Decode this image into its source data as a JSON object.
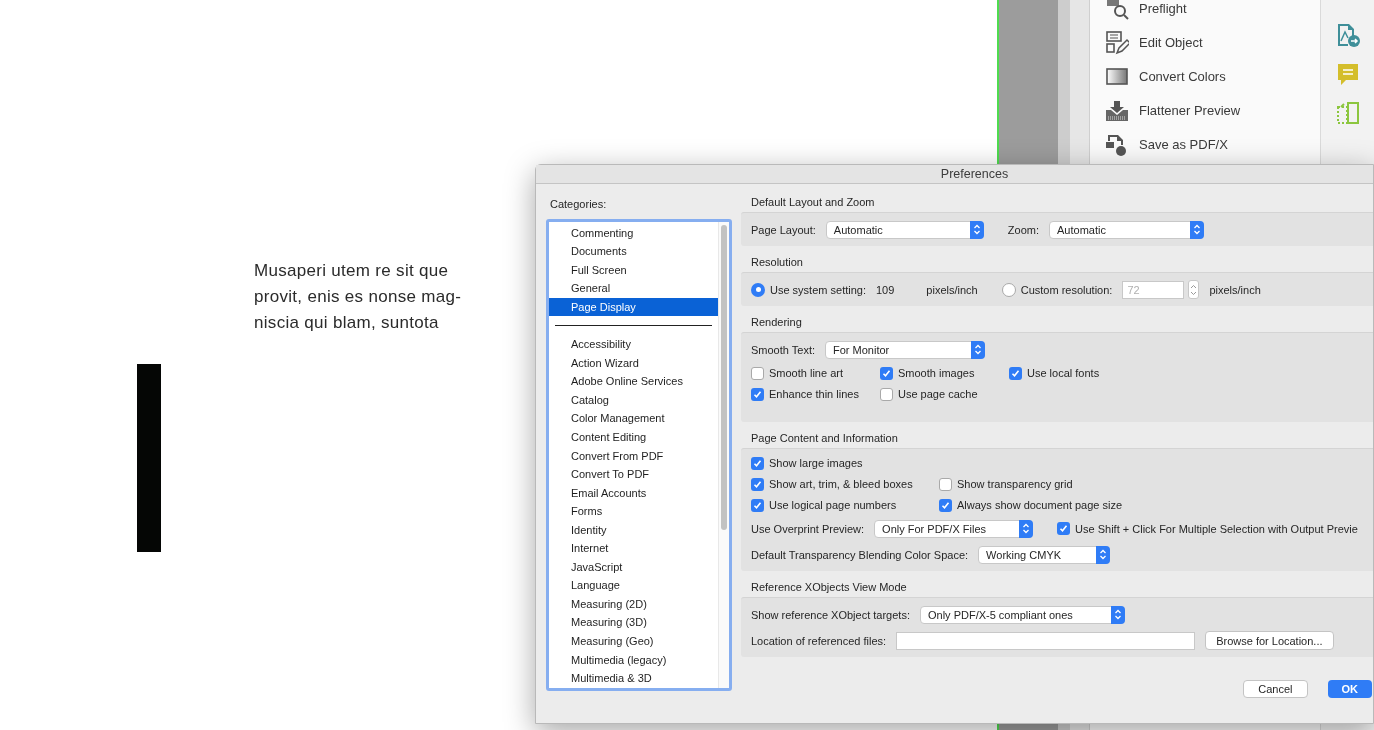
{
  "document": {
    "body_lines": [
      "Musaperi utem re sit que",
      "provit, enis es nonse mag-",
      "niscia qui blam, suntota"
    ]
  },
  "tools_panel": {
    "items": [
      {
        "label": "Preflight",
        "kind": "preflight"
      },
      {
        "label": "Edit Object",
        "kind": "edit"
      },
      {
        "label": "Convert Colors",
        "kind": "colors"
      },
      {
        "label": "Flattener Preview",
        "kind": "flatten"
      },
      {
        "label": "Save as PDF/X",
        "kind": "save"
      }
    ]
  },
  "dialog": {
    "title": "Preferences",
    "categories_label": "Categories:",
    "categories": [
      {
        "label": "Commenting",
        "selected": false
      },
      {
        "label": "Documents",
        "selected": false
      },
      {
        "label": "Full Screen",
        "selected": false
      },
      {
        "label": "General",
        "selected": false
      },
      {
        "label": "Page Display",
        "selected": true
      },
      {
        "kind": "separator"
      },
      {
        "label": "Accessibility",
        "selected": false
      },
      {
        "label": "Action Wizard",
        "selected": false
      },
      {
        "label": "Adobe Online Services",
        "selected": false
      },
      {
        "label": "Catalog",
        "selected": false
      },
      {
        "label": "Color Management",
        "selected": false
      },
      {
        "label": "Content Editing",
        "selected": false
      },
      {
        "label": "Convert From PDF",
        "selected": false
      },
      {
        "label": "Convert To PDF",
        "selected": false
      },
      {
        "label": "Email Accounts",
        "selected": false
      },
      {
        "label": "Forms",
        "selected": false
      },
      {
        "label": "Identity",
        "selected": false
      },
      {
        "label": "Internet",
        "selected": false
      },
      {
        "label": "JavaScript",
        "selected": false
      },
      {
        "label": "Language",
        "selected": false
      },
      {
        "label": "Measuring (2D)",
        "selected": false
      },
      {
        "label": "Measuring (3D)",
        "selected": false
      },
      {
        "label": "Measuring (Geo)",
        "selected": false
      },
      {
        "label": "Multimedia (legacy)",
        "selected": false
      },
      {
        "label": "Multimedia & 3D",
        "selected": false
      }
    ],
    "sections": [
      {
        "title": "Default Layout and Zoom",
        "rows": [
          {
            "kind": "controls",
            "items": [
              {
                "kind": "text",
                "text": "Page Layout:"
              },
              {
                "kind": "select",
                "value": "Automatic"
              },
              {
                "kind": "text",
                "text": "Zoom:"
              },
              {
                "kind": "select",
                "value": "Automatic"
              }
            ]
          }
        ]
      },
      {
        "title": "Resolution",
        "rows": [
          {
            "kind": "controls",
            "items": [
              {
                "kind": "radio",
                "label": "Use system setting:",
                "selected": true
              },
              {
                "kind": "text",
                "text": "109"
              },
              {
                "kind": "text",
                "text": "pixels/inch"
              },
              {
                "kind": "radio",
                "label": "Custom resolution:",
                "selected": false
              },
              {
                "kind": "input",
                "value": "72",
                "disabled": true
              },
              {
                "kind": "spinner"
              },
              {
                "kind": "text",
                "text": "pixels/inch"
              }
            ]
          }
        ]
      },
      {
        "title": "Rendering",
        "rows": [
          {
            "kind": "controls",
            "items": [
              {
                "kind": "text",
                "text": "Smooth Text:"
              },
              {
                "kind": "select",
                "value": "For Monitor"
              }
            ]
          },
          {
            "kind": "checks",
            "items": [
              {
                "label": "Smooth line art",
                "checked": false
              },
              {
                "label": "Smooth images",
                "checked": true
              },
              {
                "label": "Use local fonts",
                "checked": true
              }
            ]
          },
          {
            "kind": "checks",
            "items": [
              {
                "label": "Enhance thin lines",
                "checked": true
              },
              {
                "label": "Use page cache",
                "checked": false
              }
            ]
          }
        ]
      },
      {
        "title": "Page Content and Information",
        "rows": [
          {
            "kind": "checks",
            "items": [
              {
                "label": "Show large images",
                "checked": true
              }
            ]
          },
          {
            "kind": "checks",
            "items": [
              {
                "label": "Show art, trim, & bleed boxes",
                "checked": true
              },
              {
                "label": "Show transparency grid",
                "checked": false
              }
            ]
          },
          {
            "kind": "checks",
            "items": [
              {
                "label": "Use logical page numbers",
                "checked": true
              },
              {
                "label": "Always show document page size",
                "checked": true
              }
            ]
          },
          {
            "kind": "controls",
            "items": [
              {
                "kind": "text",
                "text": "Use Overprint Preview:"
              },
              {
                "kind": "select",
                "value": "Only For PDF/X Files"
              },
              {
                "kind": "checkbox",
                "label": "Use Shift + Click For Multiple Selection with Output Previe",
                "checked": true
              }
            ]
          },
          {
            "kind": "controls",
            "items": [
              {
                "kind": "text",
                "text": "Default Transparency Blending Color Space:"
              },
              {
                "kind": "select",
                "value": "Working CMYK"
              }
            ]
          }
        ]
      },
      {
        "title": "Reference XObjects View Mode",
        "rows": [
          {
            "kind": "controls",
            "items": [
              {
                "kind": "text",
                "text": "Show reference XObject targets:"
              },
              {
                "kind": "select",
                "value": "Only PDF/X-5 compliant ones"
              }
            ]
          },
          {
            "kind": "controls",
            "items": [
              {
                "kind": "text",
                "text": "Location of referenced files:"
              },
              {
                "kind": "input"
              },
              {
                "kind": "button",
                "label": "Browse for Location..."
              }
            ]
          }
        ]
      }
    ],
    "buttons": [
      {
        "label": "Cancel",
        "default": false
      },
      {
        "label": "OK",
        "default": true
      }
    ]
  }
}
